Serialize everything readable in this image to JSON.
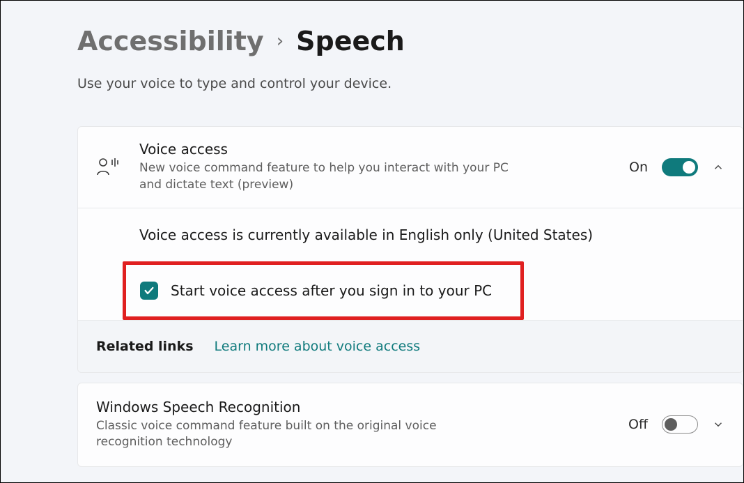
{
  "breadcrumb": {
    "parent": "Accessibility",
    "separator": "›",
    "current": "Speech"
  },
  "subtitle": "Use your voice to type and control your device.",
  "voice_access": {
    "title": "Voice access",
    "desc": "New voice command feature to help you interact with your PC and dictate text (preview)",
    "status": "On",
    "info": "Voice access is currently available in English only (United States)",
    "checkbox_label": "Start voice access after you sign in to your PC",
    "checkbox_checked": true,
    "related_label": "Related links",
    "related_link": "Learn more about voice access"
  },
  "speech_recognition": {
    "title": "Windows Speech Recognition",
    "desc": "Classic voice command feature built on the original voice recognition technology",
    "status": "Off"
  }
}
